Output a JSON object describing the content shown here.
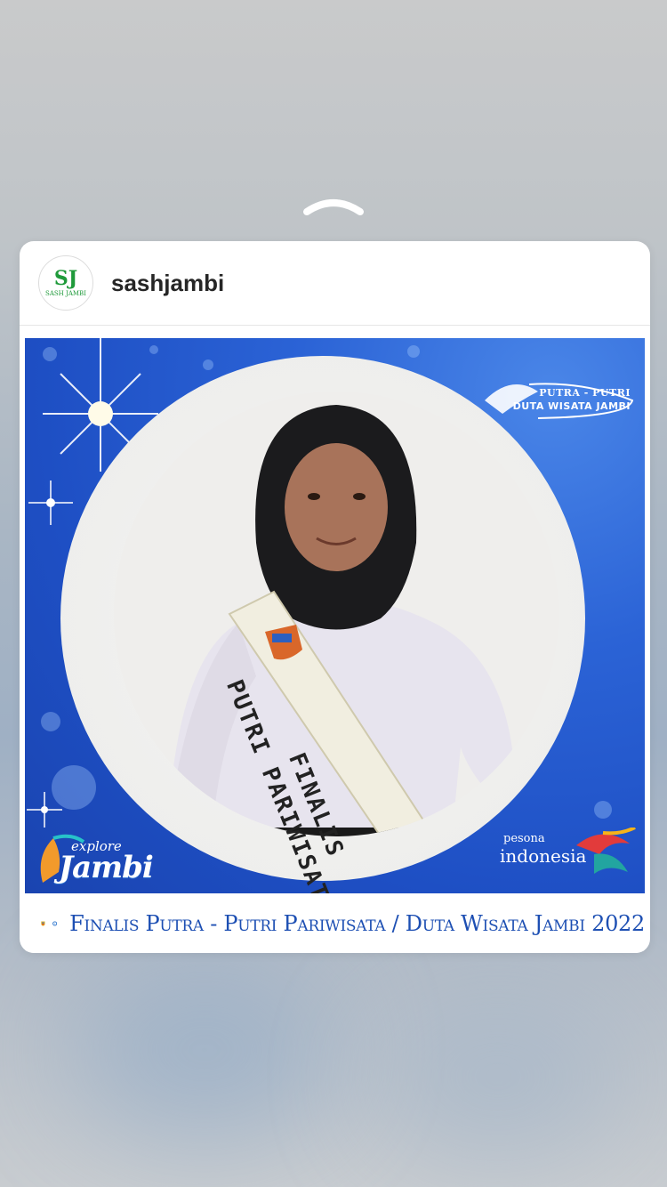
{
  "post": {
    "username": "sashjambi",
    "avatar": {
      "mark": "SJ",
      "text": "SASH JAMBI"
    }
  },
  "image": {
    "brand_top": {
      "line1": "PUTRA - PUTRI",
      "line2": "DUTA WISATA JAMBI"
    },
    "sash": {
      "line1": "PUTRI PARIWISATA",
      "line2": "FINALIS"
    },
    "explore_logo": {
      "small": "explore",
      "big": "Jambi"
    },
    "pesona_logo": {
      "small": "pesona",
      "big": "indonesia"
    }
  },
  "caption": "Finalis Putra - Putri Pariwisata / Duta Wisata Jambi 2022",
  "colors": {
    "accent_blue": "#1d4fb3",
    "username": "#262626",
    "logo_green": "#1f9a3a"
  },
  "icons": [
    "chevron-up-icon",
    "avatar-logo",
    "jambi-emblem-icon",
    "kemdikbud-emblem-icon"
  ]
}
